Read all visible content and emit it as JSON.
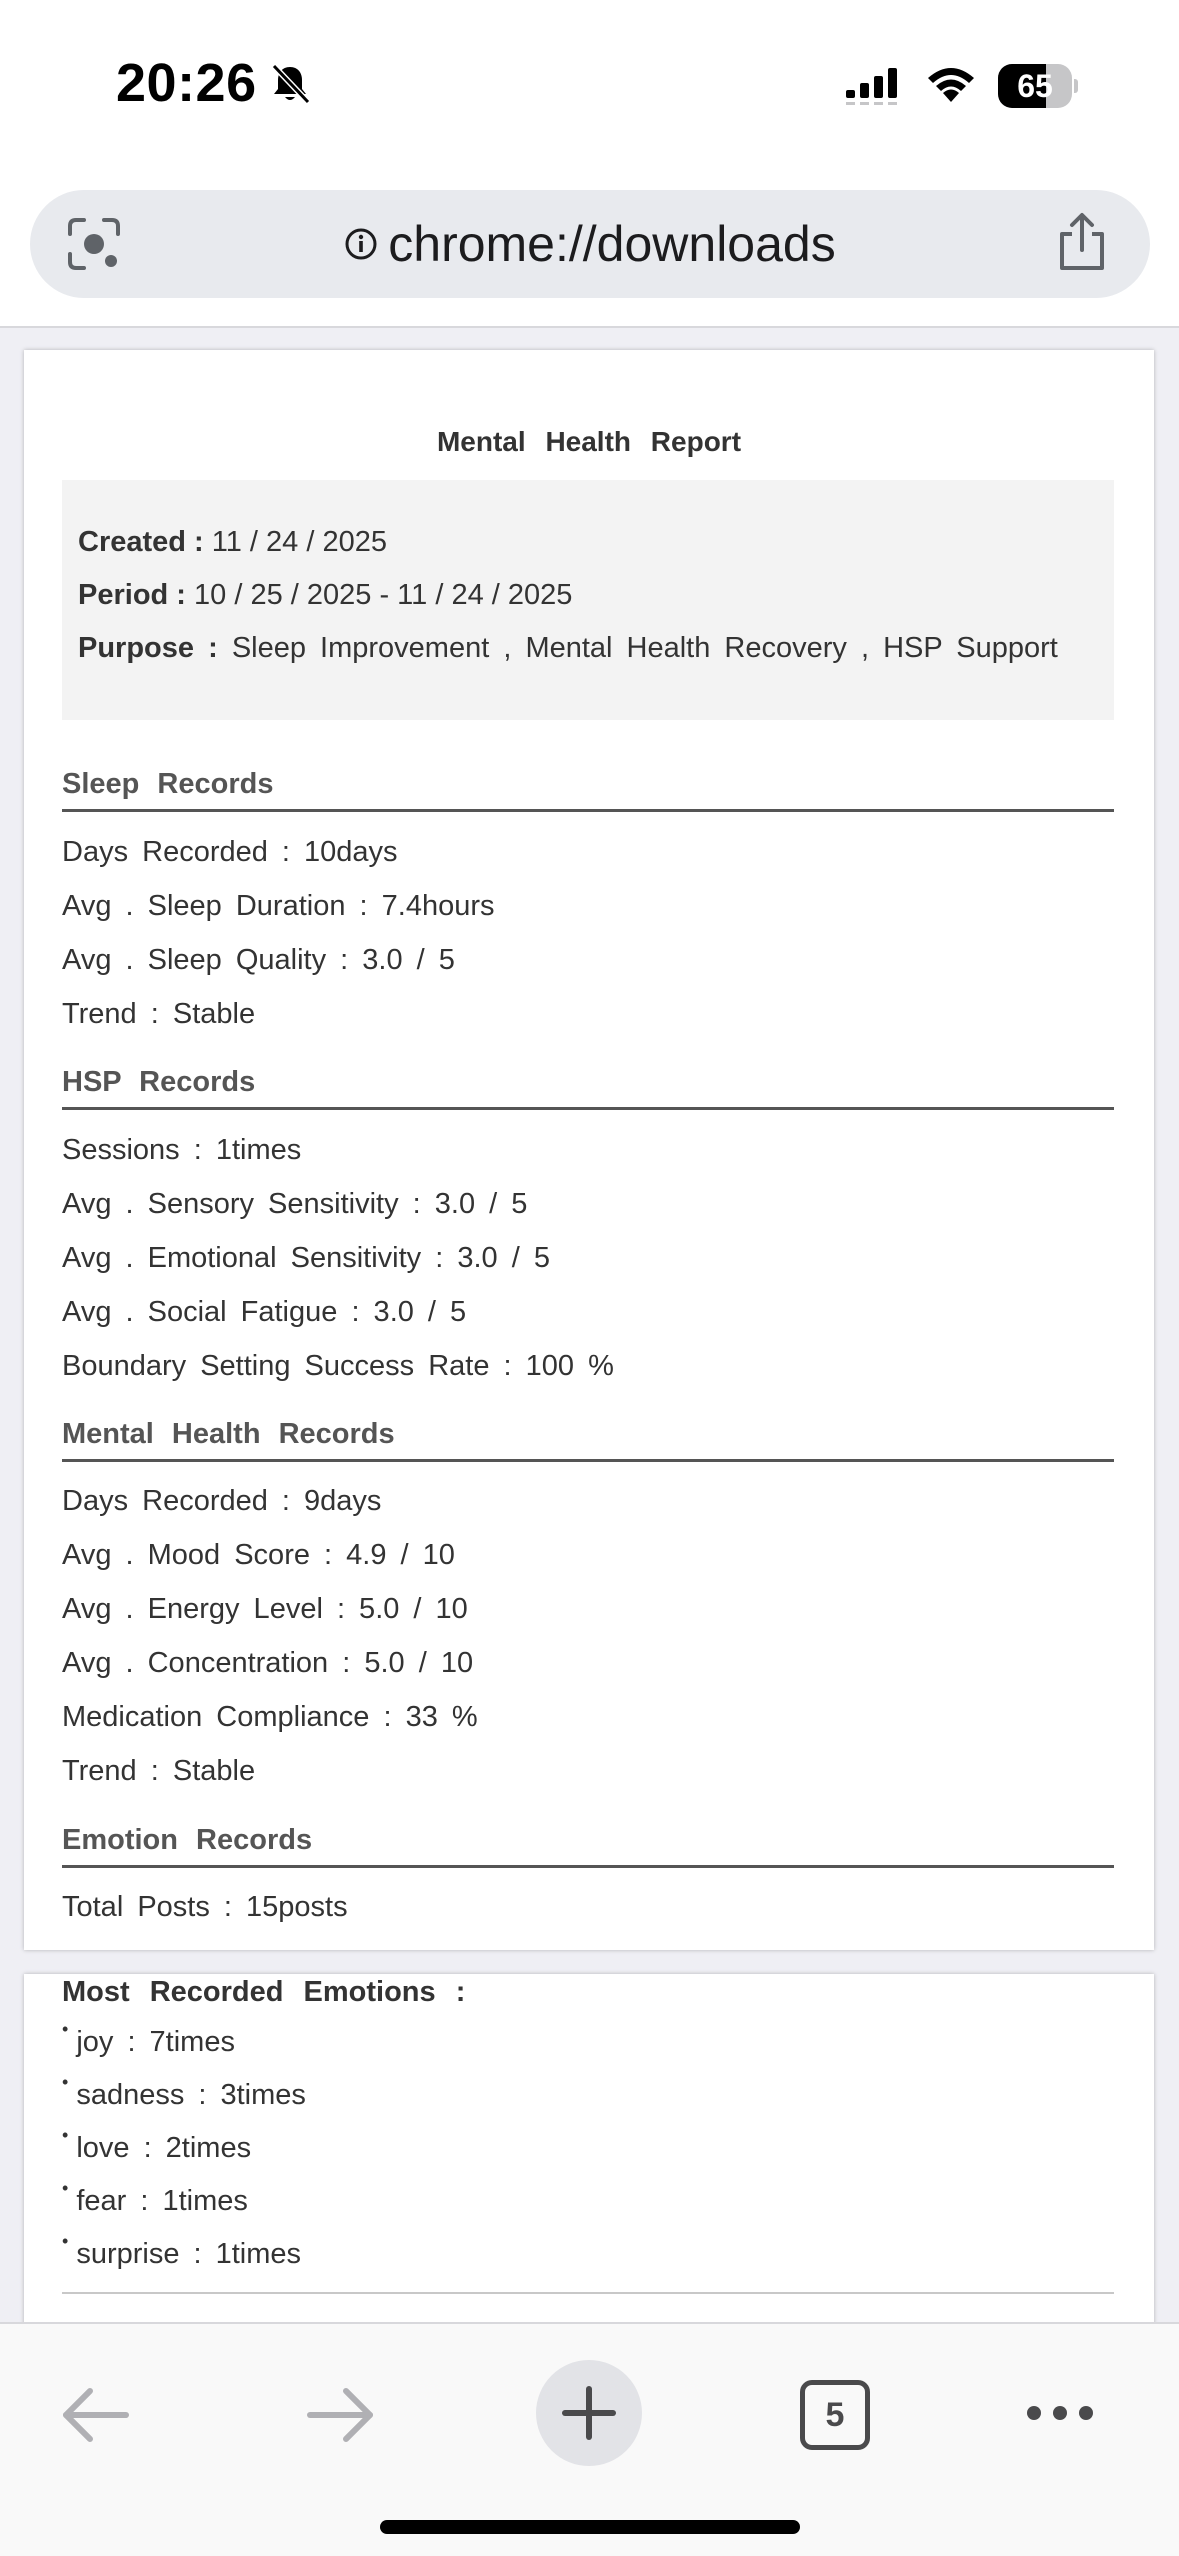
{
  "status_bar": {
    "time": "20:26",
    "battery": "65",
    "battery_level": 0.65,
    "icons": [
      "bell-slash-icon",
      "cellular-signal-icon",
      "wifi-icon",
      "battery-icon"
    ]
  },
  "browser": {
    "url": "chrome://downloads",
    "icons": [
      "lens-icon",
      "info-icon",
      "share-icon"
    ]
  },
  "report": {
    "title": "Mental Health Report",
    "created_label": "Created :",
    "created_value": "11 / 24 / 2025",
    "period_label": "Period :",
    "period_value": "10 / 25 / 2025 - 11 / 24 / 2025",
    "purpose_label": "Purpose :",
    "purpose_value": "Sleep Improvement , Mental Health Recovery , HSP Support",
    "sleep": {
      "heading": "Sleep Records",
      "rows": [
        "Days Recorded : 10days",
        "Avg . Sleep Duration : 7.4hours",
        "Avg . Sleep Quality : 3.0 / 5",
        "Trend : Stable"
      ]
    },
    "hsp": {
      "heading": "HSP Records",
      "rows": [
        "Sessions : 1times",
        "Avg . Sensory Sensitivity : 3.0 / 5",
        "Avg . Emotional Sensitivity : 3.0 / 5",
        "Avg . Social Fatigue : 3.0 / 5",
        "Boundary Setting Success Rate : 100 %"
      ]
    },
    "mental": {
      "heading": "Mental Health Records",
      "rows": [
        "Days Recorded : 9days",
        "Avg . Mood Score : 4.9 / 10",
        "Avg . Energy Level : 5.0 / 10",
        "Avg . Concentration : 5.0 / 10",
        "Medication Compliance : 33 %",
        "Trend : Stable"
      ]
    },
    "emotion": {
      "heading": "Emotion Records",
      "total": "Total Posts : 15posts",
      "most_heading": "Most Recorded Emotions :",
      "items": [
        "joy : 7times",
        "sadness : 3times",
        "love : 2times",
        "fear : 1times",
        "surprise : 1times"
      ]
    }
  },
  "toolbar": {
    "tab_count": "5",
    "icons": [
      "back-arrow-icon",
      "forward-arrow-icon",
      "plus-icon",
      "tabs-icon",
      "more-icon"
    ]
  }
}
